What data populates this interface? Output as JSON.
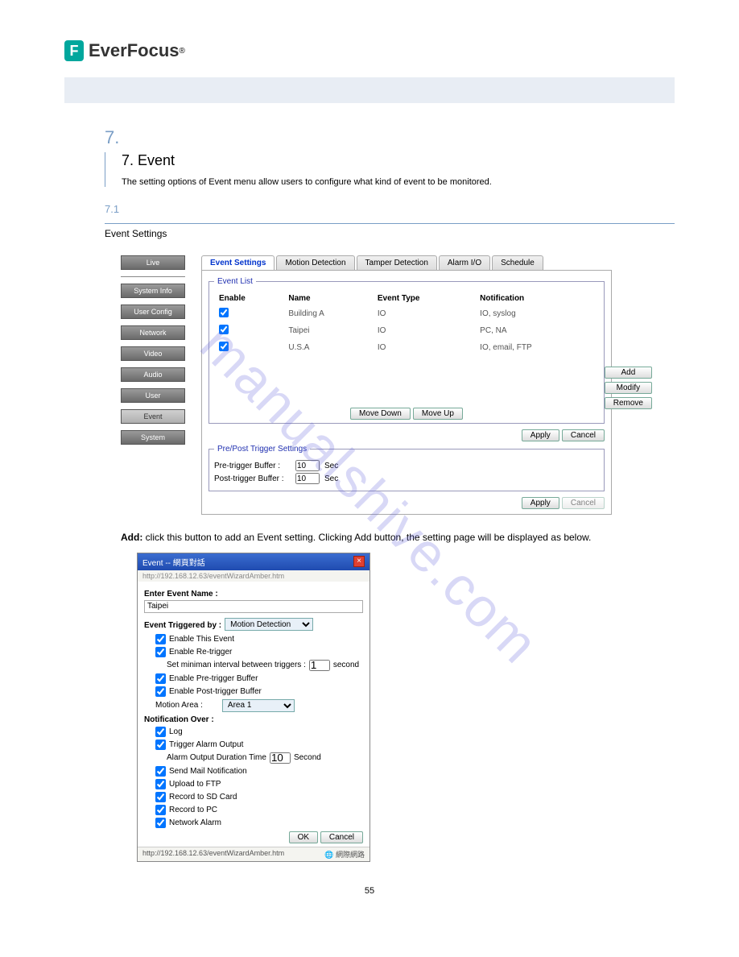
{
  "logo": {
    "text": "EverFocus",
    "reg": "®"
  },
  "chapter": {
    "number": "7.",
    "title": "7. Event"
  },
  "intro": "The setting options of Event menu allow users to configure what kind of event to be monitored.",
  "section": {
    "number": "7.1",
    "title": "Event Settings"
  },
  "sidebar": [
    "Live",
    "System Info",
    "User Config",
    "Network",
    "Video",
    "Audio",
    "User",
    "Event",
    "System"
  ],
  "tabs": [
    "Event Settings",
    "Motion Detection",
    "Tamper Detection",
    "Alarm I/O",
    "Schedule"
  ],
  "eventList": {
    "legend": "Event List",
    "headers": {
      "enable": "Enable",
      "name": "Name",
      "type": "Event Type",
      "notif": "Notification"
    },
    "rows": [
      {
        "name": "Building A",
        "type": "IO",
        "notif": "IO, syslog"
      },
      {
        "name": "Taipei",
        "type": "IO",
        "notif": "PC, NA"
      },
      {
        "name": "U.S.A",
        "type": "IO",
        "notif": "IO, email, FTP"
      }
    ],
    "moveDown": "Move Down",
    "moveUp": "Move Up",
    "add": "Add",
    "modify": "Modify",
    "remove": "Remove",
    "apply": "Apply",
    "cancel": "Cancel"
  },
  "prePost": {
    "legend": "Pre/Post Trigger Settings",
    "pre": "Pre-trigger Buffer :",
    "post": "Post-trigger Buffer :",
    "preVal": "10",
    "postVal": "10",
    "sec": "Sec",
    "apply": "Apply",
    "cancel": "Cancel"
  },
  "paragraph": {
    "addLabel": "Add:",
    "addText": " click this button to add an Event setting. Clicking Add button, the setting page will be displayed as below."
  },
  "dialog": {
    "title": "Event -- 網頁對話",
    "url": "http://192.168.12.63/eventWizardAmber.htm",
    "enterName": "Enter Event Name :",
    "nameVal": "Taipei",
    "triggeredBy": "Event Triggered by :",
    "triggeredVal": "Motion Detection",
    "enableEvent": "Enable This Event",
    "enableRetrigger": "Enable Re-trigger",
    "minInterval": "Set miniman interval between triggers :",
    "minVal": "1",
    "second": "second",
    "enablePre": "Enable Pre-trigger Buffer",
    "enablePost": "Enable Post-trigger Buffer",
    "motionArea": "Motion Area :",
    "areaVal": "Area 1",
    "notifOver": "Notification Over :",
    "log": "Log",
    "triggerAlarm": "Trigger Alarm Output",
    "alarmDur": "Alarm Output Duration Time",
    "alarmVal": "10",
    "alarmSec": "Second",
    "sendMail": "Send Mail Notification",
    "uploadFtp": "Upload to FTP",
    "recordSd": "Record to SD Card",
    "recordPc": "Record to PC",
    "networkAlarm": "Network Alarm",
    "ok": "OK",
    "cancel": "Cancel",
    "statusUrl": "http://192.168.12.63/eventWizardAmber.htm",
    "statusNet": "網際網路"
  },
  "pageNum": "55",
  "watermark": "manualshive.com"
}
